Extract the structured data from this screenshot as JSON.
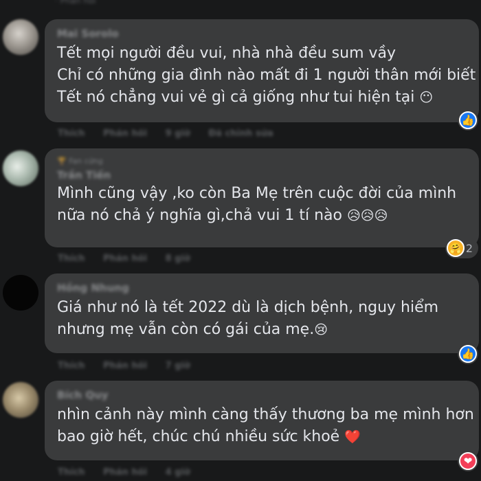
{
  "top_actions": "· Phản hồi",
  "comments": [
    {
      "author": "Mai Sorolo",
      "badge": "",
      "lines": [
        "Tết mọi người đều vui, nhà nhà đều sum vầy",
        "Chỉ có những gia đình nào mất đi 1 người thân mới biết",
        "Tết nó chẳng vui vẻ gì cả giống như tui hiện tại"
      ],
      "line_emojis": [
        "",
        "",
        "😶"
      ],
      "actions": [
        "Thích",
        "Phản hồi",
        "9 giờ",
        "Đã chỉnh sửa"
      ],
      "reaction": {
        "type": "like",
        "icon": "👍",
        "count": ""
      }
    },
    {
      "author": "Trần Tiến",
      "badge": "🏆 Fan cứng",
      "lines": [
        "Mình cũng vậy ,ko còn Ba Mẹ trên cuộc đời của mình",
        "nữa nó chả ý nghĩa gì,chả vui 1 tí nào"
      ],
      "line_emojis": [
        "",
        "😥😥😥"
      ],
      "actions": [
        "Thích",
        "Phản hồi",
        "8 giờ"
      ],
      "reaction": {
        "type": "care",
        "icon": "🤗",
        "count": "2"
      }
    },
    {
      "author": "Hồng Nhung",
      "badge": "",
      "lines": [
        "Giá như nó là tết 2022 dù là dịch bệnh, nguy hiểm",
        "nhưng mẹ vẫn còn có gái của mẹ."
      ],
      "line_emojis": [
        "",
        "😢"
      ],
      "actions": [
        "Thích",
        "Phản hồi",
        "7 giờ"
      ],
      "reaction": {
        "type": "like",
        "icon": "👍",
        "count": ""
      }
    },
    {
      "author": "Bích Quy",
      "badge": "",
      "lines": [
        "nhìn cảnh này mình càng thấy thương ba mẹ mình hơn",
        "bao giờ hết, chúc chú nhiều sức khoẻ"
      ],
      "line_emojis": [
        "",
        "❤️"
      ],
      "actions": [
        "Thích",
        "Phản hồi",
        "4 giờ"
      ],
      "reaction": {
        "type": "love",
        "icon": "❤",
        "count": ""
      }
    }
  ]
}
